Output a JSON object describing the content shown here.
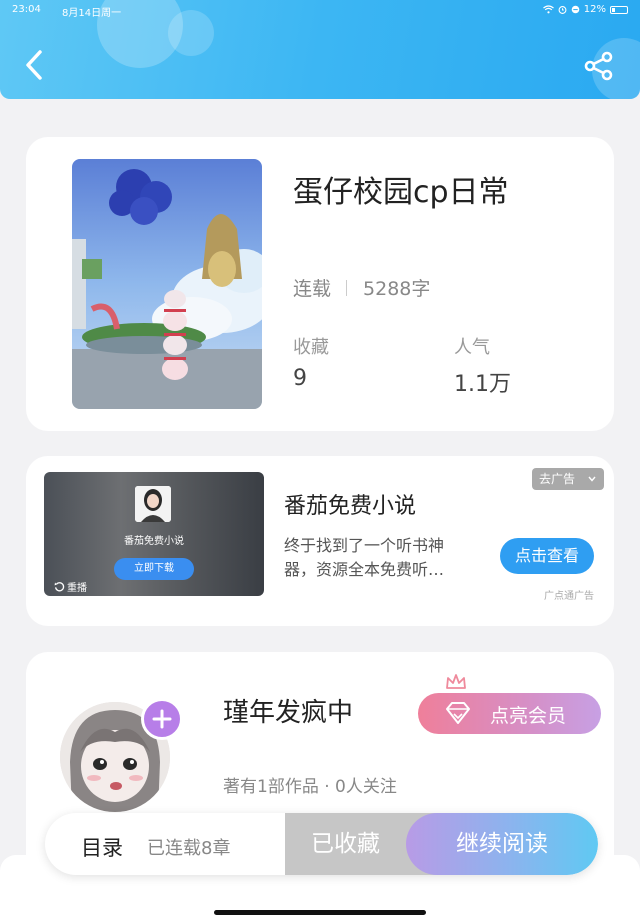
{
  "status_bar": {
    "time": "23:04",
    "date": "8月14日周一",
    "battery": "12%"
  },
  "header": {
    "back_icon": "chevron-left-icon",
    "share_icon": "share-icon"
  },
  "book": {
    "title": "蛋仔校园cp日常",
    "status": "连载",
    "word_count": "5288字",
    "favorites_label": "收藏",
    "favorites_value": "9",
    "popularity_label": "人气",
    "popularity_value": "1.1万"
  },
  "ad": {
    "video_app_name": "番茄免费小说",
    "video_button": "立即下载",
    "video_replay": "重播",
    "tag": "去广告",
    "title": "番茄免费小说",
    "desc_line1": "终于找到了一个听书神",
    "desc_line2": "器，资源全本免费听…",
    "button": "点击查看",
    "source": "广点通广告"
  },
  "author": {
    "name": "瑾年发疯中",
    "meta": "著有1部作品 · 0人关注",
    "vip_button": "点亮会员"
  },
  "bottom_bar": {
    "toc": "目录",
    "chapters": "已连载8章",
    "collected": "已收藏",
    "continue": "继续阅读"
  },
  "colors": {
    "header": "#3cb6f3",
    "accent_blue": "#2f9ef2",
    "vip_pink": "#ef7f9a",
    "follow_purple": "#b77ee8"
  }
}
